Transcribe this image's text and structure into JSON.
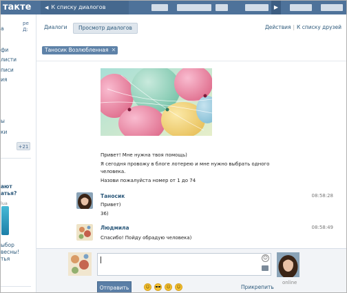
{
  "topbar": {
    "logo": "такте",
    "back_link": "К списку диалогов",
    "play_icon": "▶"
  },
  "sidebar": {
    "top_fragment": "ре\nД:",
    "items": [
      "фи",
      "листи",
      "писи",
      "ия",
      "ы",
      "ки"
    ],
    "badge": "+21",
    "ad": {
      "title": "ают\nатья?",
      "site": "lua",
      "text": "ыбор\nвесны!\nтья"
    }
  },
  "tabs": {
    "dialogs": "Диалоги",
    "view": "Просмотр диалогов",
    "actions": "Действия",
    "friends_list": "К списку друзей"
  },
  "filter": {
    "chip": "Таносик Возлюбленная",
    "chip_close": "✕"
  },
  "messages": [
    {
      "lines": [
        "Привет! Мне нужна твоя помощь)",
        "Я сегодня провожу в блоге лотерею и мне нужно выбрать одного",
        "человека.",
        "Назови пожалуйста номер от 1 до 74"
      ]
    },
    {
      "author": "Таносик",
      "time": "08:58:28",
      "lines": [
        "Привет)",
        "36)"
      ]
    },
    {
      "author": "Людмила",
      "time": "08:58:49",
      "lines": [
        "Спасибо! Пойду обрадую человека)"
      ]
    }
  ],
  "composer": {
    "send": "Отправить",
    "attach": "Прикрепить",
    "online": "online",
    "emojis": [
      "☺",
      "😎",
      "☹",
      "☺"
    ]
  },
  "colors": {
    "topbar": "#4e729a",
    "accent": "#2b587a",
    "button": "#5a7ea6"
  }
}
